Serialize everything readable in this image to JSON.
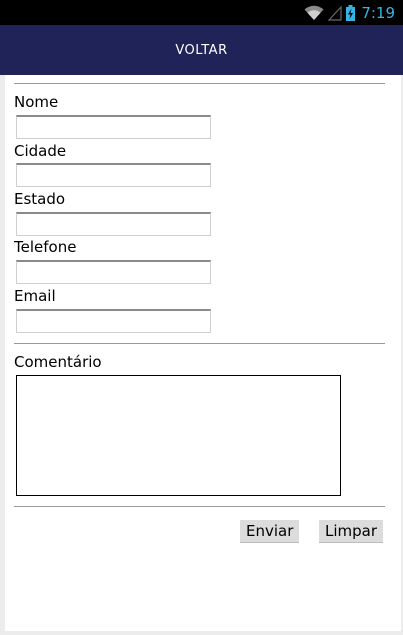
{
  "status_bar": {
    "time": "7:19",
    "icons": [
      "wifi-icon",
      "signal-icon",
      "battery-charging-icon"
    ],
    "accent_color": "#33b5e5"
  },
  "app_bar": {
    "back_label": "VOLTAR",
    "background_color": "#1f2358"
  },
  "form": {
    "fields": [
      {
        "label": "Nome",
        "value": ""
      },
      {
        "label": "Cidade",
        "value": ""
      },
      {
        "label": "Estado",
        "value": ""
      },
      {
        "label": "Telefone",
        "value": ""
      },
      {
        "label": "Email",
        "value": ""
      }
    ],
    "comment": {
      "label": "Comentário",
      "value": ""
    },
    "buttons": {
      "submit": "Enviar",
      "clear": "Limpar"
    }
  }
}
